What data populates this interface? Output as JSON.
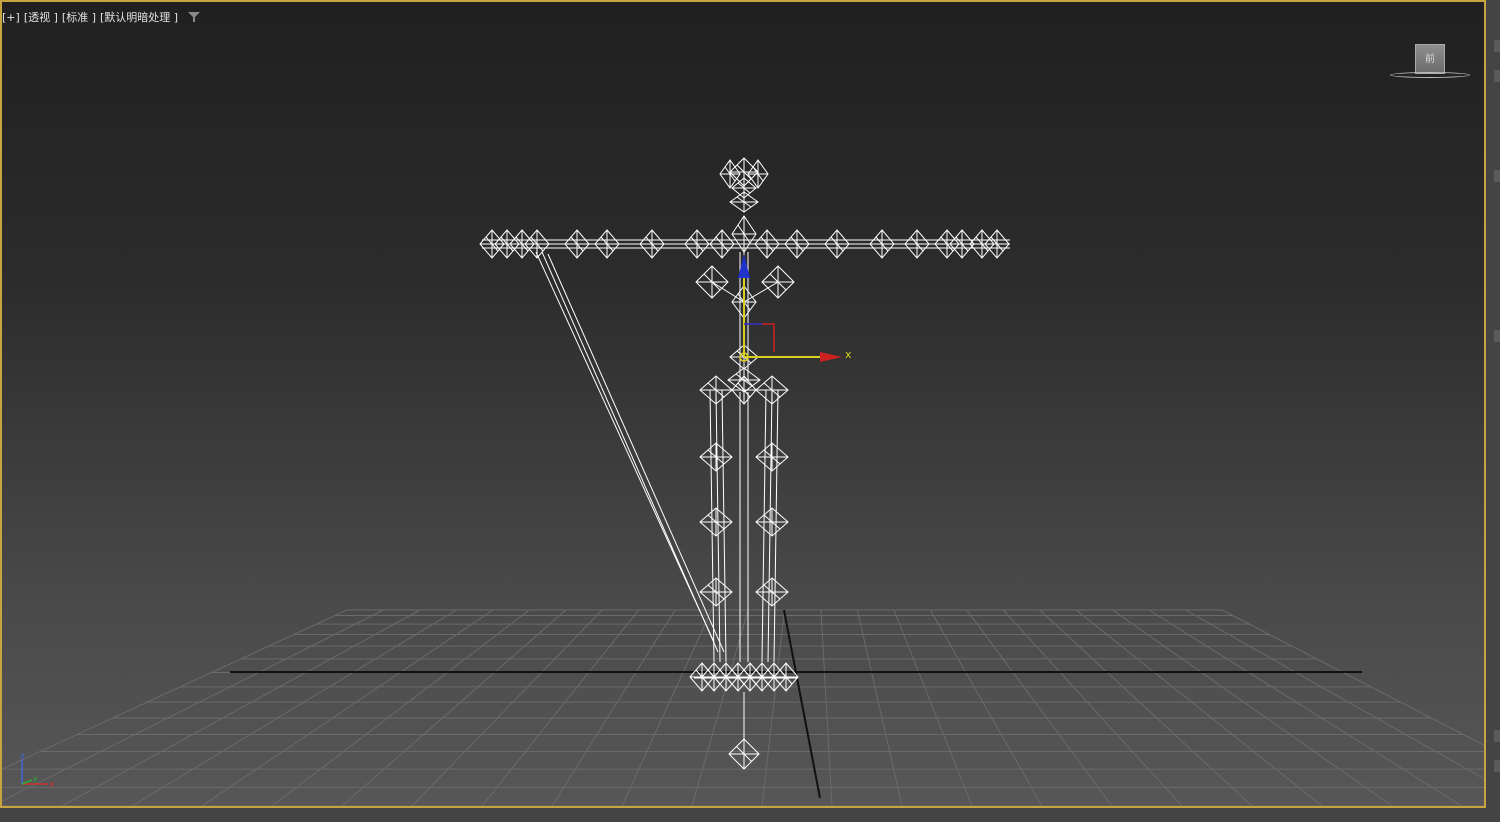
{
  "viewport": {
    "menus": {
      "plus": "[+]",
      "view": "[透视 ]",
      "shading_preset": "[标准 ]",
      "lighting": "[默认明暗处理 ]"
    },
    "filter_icon": "filter-icon",
    "viewcube_label": "前",
    "gizmo_x_label": "x",
    "tripod": {
      "z": "z",
      "y": "y",
      "x": "x"
    }
  },
  "colors": {
    "border_active": "#c8a440",
    "gizmo_x": "#cc2222",
    "gizmo_y": "#d8d020",
    "gizmo_z": "#2233cc",
    "wireframe": "#ffffff",
    "grid": "#6a6a6a"
  }
}
